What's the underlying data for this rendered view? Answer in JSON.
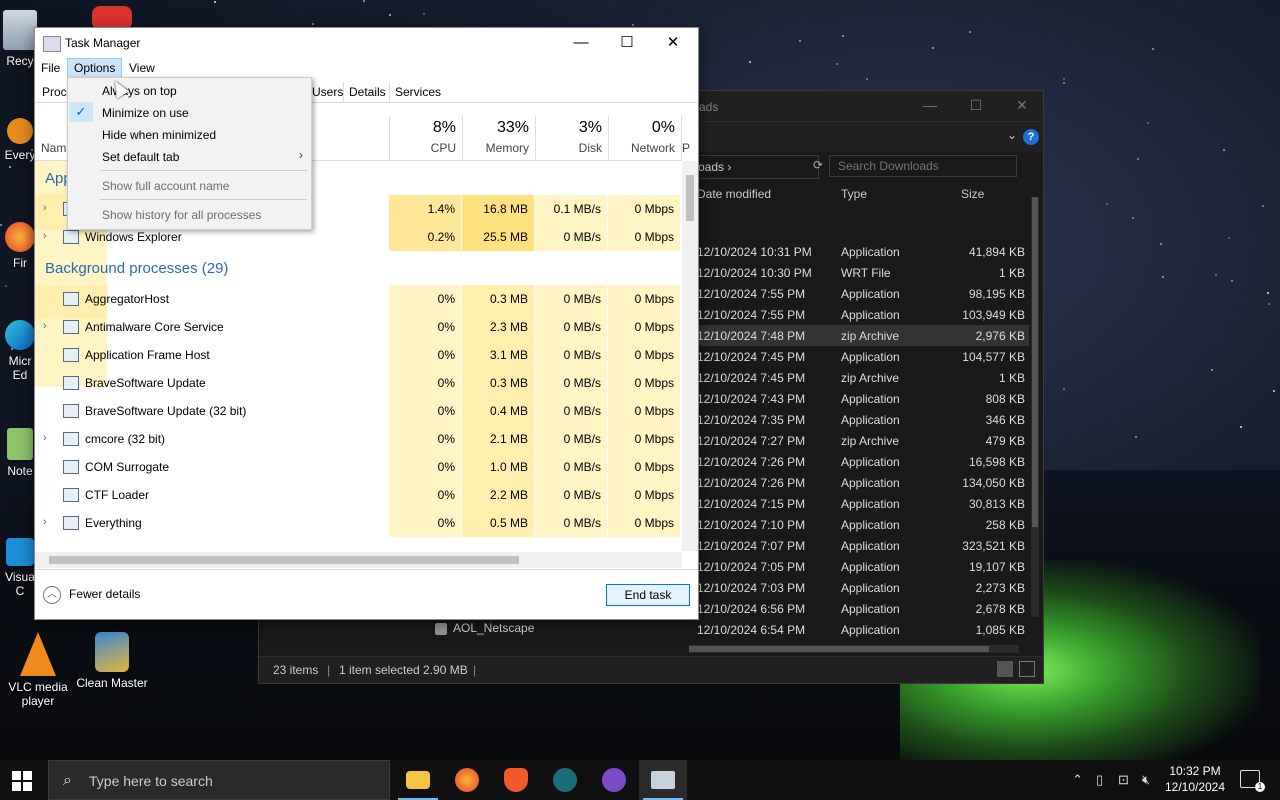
{
  "desktop": {
    "icons": [
      {
        "label": "Recy",
        "name": "recycle-bin"
      },
      {
        "label": "Every",
        "name": "everything"
      },
      {
        "label": "Fir",
        "name": "firefox"
      },
      {
        "label": "Micr Ed",
        "name": "edge"
      },
      {
        "label": "Note",
        "name": "notepad"
      },
      {
        "label": "Visua C",
        "name": "vscode"
      },
      {
        "label": "VLC media player",
        "name": "vlc"
      },
      {
        "label": "Clean Master",
        "name": "clean-master"
      }
    ]
  },
  "explorer": {
    "title": "ads",
    "address": "oads",
    "search_placeholder": "Search Downloads",
    "columns": {
      "date": "Date modified",
      "type": "Type",
      "size": "Size"
    },
    "rows": [
      {
        "date": "12/10/2024 10:31 PM",
        "type": "Application",
        "size": "41,894 KB"
      },
      {
        "date": "12/10/2024 10:30 PM",
        "type": "WRT File",
        "size": "1 KB"
      },
      {
        "date": "12/10/2024 7:55 PM",
        "type": "Application",
        "size": "98,195 KB"
      },
      {
        "date": "12/10/2024 7:55 PM",
        "type": "Application",
        "size": "103,949 KB"
      },
      {
        "date": "12/10/2024 7:48 PM",
        "type": "zip Archive",
        "size": "2,976 KB",
        "selected": true
      },
      {
        "date": "12/10/2024 7:45 PM",
        "type": "Application",
        "size": "104,577 KB"
      },
      {
        "date": "12/10/2024 7:45 PM",
        "type": "zip Archive",
        "size": "1 KB"
      },
      {
        "date": "12/10/2024 7:43 PM",
        "type": "Application",
        "size": "808 KB"
      },
      {
        "date": "12/10/2024 7:35 PM",
        "type": "Application",
        "size": "346 KB"
      },
      {
        "date": "12/10/2024 7:27 PM",
        "type": "zip Archive",
        "size": "479 KB"
      },
      {
        "date": "12/10/2024 7:26 PM",
        "type": "Application",
        "size": "16,598 KB"
      },
      {
        "date": "12/10/2024 7:26 PM",
        "type": "Application",
        "size": "134,050 KB"
      },
      {
        "date": "12/10/2024 7:15 PM",
        "type": "Application",
        "size": "30,813 KB"
      },
      {
        "date": "12/10/2024 7:10 PM",
        "type": "Application",
        "size": "258 KB"
      },
      {
        "date": "12/10/2024 7:07 PM",
        "type": "Application",
        "size": "323,521 KB"
      },
      {
        "date": "12/10/2024 7:05 PM",
        "type": "Application",
        "size": "19,107 KB"
      },
      {
        "date": "12/10/2024 7:03 PM",
        "type": "Application",
        "size": "2,273 KB"
      },
      {
        "date": "12/10/2024 6:56 PM",
        "type": "Application",
        "size": "2,678 KB"
      },
      {
        "date": "12/10/2024 6:54 PM",
        "type": "Application",
        "size": "1,085 KB"
      }
    ],
    "last_name": "AOL_Netscape",
    "status": {
      "items": "23 items",
      "selected": "1 item selected  2.90 MB"
    }
  },
  "taskmanager": {
    "title": "Task Manager",
    "menu": [
      "File",
      "Options",
      "View"
    ],
    "tabs": [
      "Proc",
      "Users",
      "Details",
      "Services"
    ],
    "header": {
      "name": "Nam",
      "cpu": {
        "pct": "8%",
        "label": "CPU"
      },
      "memory": {
        "pct": "33%",
        "label": "Memory"
      },
      "disk": {
        "pct": "3%",
        "label": "Disk"
      },
      "network": {
        "pct": "0%",
        "label": "Network"
      },
      "power": "P"
    },
    "apps_group": "App",
    "bg_group": "Background processes (29)",
    "app_rows": [
      {
        "name": "",
        "cpu": "1.4%",
        "mem": "16.8 MB",
        "disk": "0.1 MB/s",
        "net": "0 Mbps",
        "expand": true
      },
      {
        "name": "Windows Explorer",
        "cpu": "0.2%",
        "mem": "25.5 MB",
        "disk": "0 MB/s",
        "net": "0 Mbps",
        "expand": true
      }
    ],
    "bg_rows": [
      {
        "name": "AggregatorHost",
        "cpu": "0%",
        "mem": "0.3 MB",
        "disk": "0 MB/s",
        "net": "0 Mbps",
        "expand": false
      },
      {
        "name": "Antimalware Core Service",
        "cpu": "0%",
        "mem": "2.3 MB",
        "disk": "0 MB/s",
        "net": "0 Mbps",
        "expand": true
      },
      {
        "name": "Application Frame Host",
        "cpu": "0%",
        "mem": "3.1 MB",
        "disk": "0 MB/s",
        "net": "0 Mbps",
        "expand": false
      },
      {
        "name": "BraveSoftware Update",
        "cpu": "0%",
        "mem": "0.3 MB",
        "disk": "0 MB/s",
        "net": "0 Mbps",
        "expand": false
      },
      {
        "name": "BraveSoftware Update (32 bit)",
        "cpu": "0%",
        "mem": "0.4 MB",
        "disk": "0 MB/s",
        "net": "0 Mbps",
        "expand": false
      },
      {
        "name": "cmcore (32 bit)",
        "cpu": "0%",
        "mem": "2.1 MB",
        "disk": "0 MB/s",
        "net": "0 Mbps",
        "expand": true
      },
      {
        "name": "COM Surrogate",
        "cpu": "0%",
        "mem": "1.0 MB",
        "disk": "0 MB/s",
        "net": "0 Mbps",
        "expand": false
      },
      {
        "name": "CTF Loader",
        "cpu": "0%",
        "mem": "2.2 MB",
        "disk": "0 MB/s",
        "net": "0 Mbps",
        "expand": false
      },
      {
        "name": "Everything",
        "cpu": "0%",
        "mem": "0.5 MB",
        "disk": "0 MB/s",
        "net": "0 Mbps",
        "expand": true
      }
    ],
    "footer": {
      "fewer": "Fewer details",
      "end_task": "End task"
    },
    "options_menu": [
      {
        "label": "Always on top",
        "checked": false,
        "disabled": false
      },
      {
        "label": "Minimize on use",
        "checked": true,
        "disabled": false
      },
      {
        "label": "Hide when minimized",
        "checked": false,
        "disabled": false
      },
      {
        "label": "Set default tab",
        "checked": false,
        "disabled": false,
        "submenu": true
      },
      {
        "label": "Show full account name",
        "checked": false,
        "disabled": true
      },
      {
        "label": "Show history for all processes",
        "checked": false,
        "disabled": true
      }
    ]
  },
  "taskbar": {
    "search_placeholder": "Type here to search",
    "time": "10:32 PM",
    "date": "12/10/2024"
  }
}
